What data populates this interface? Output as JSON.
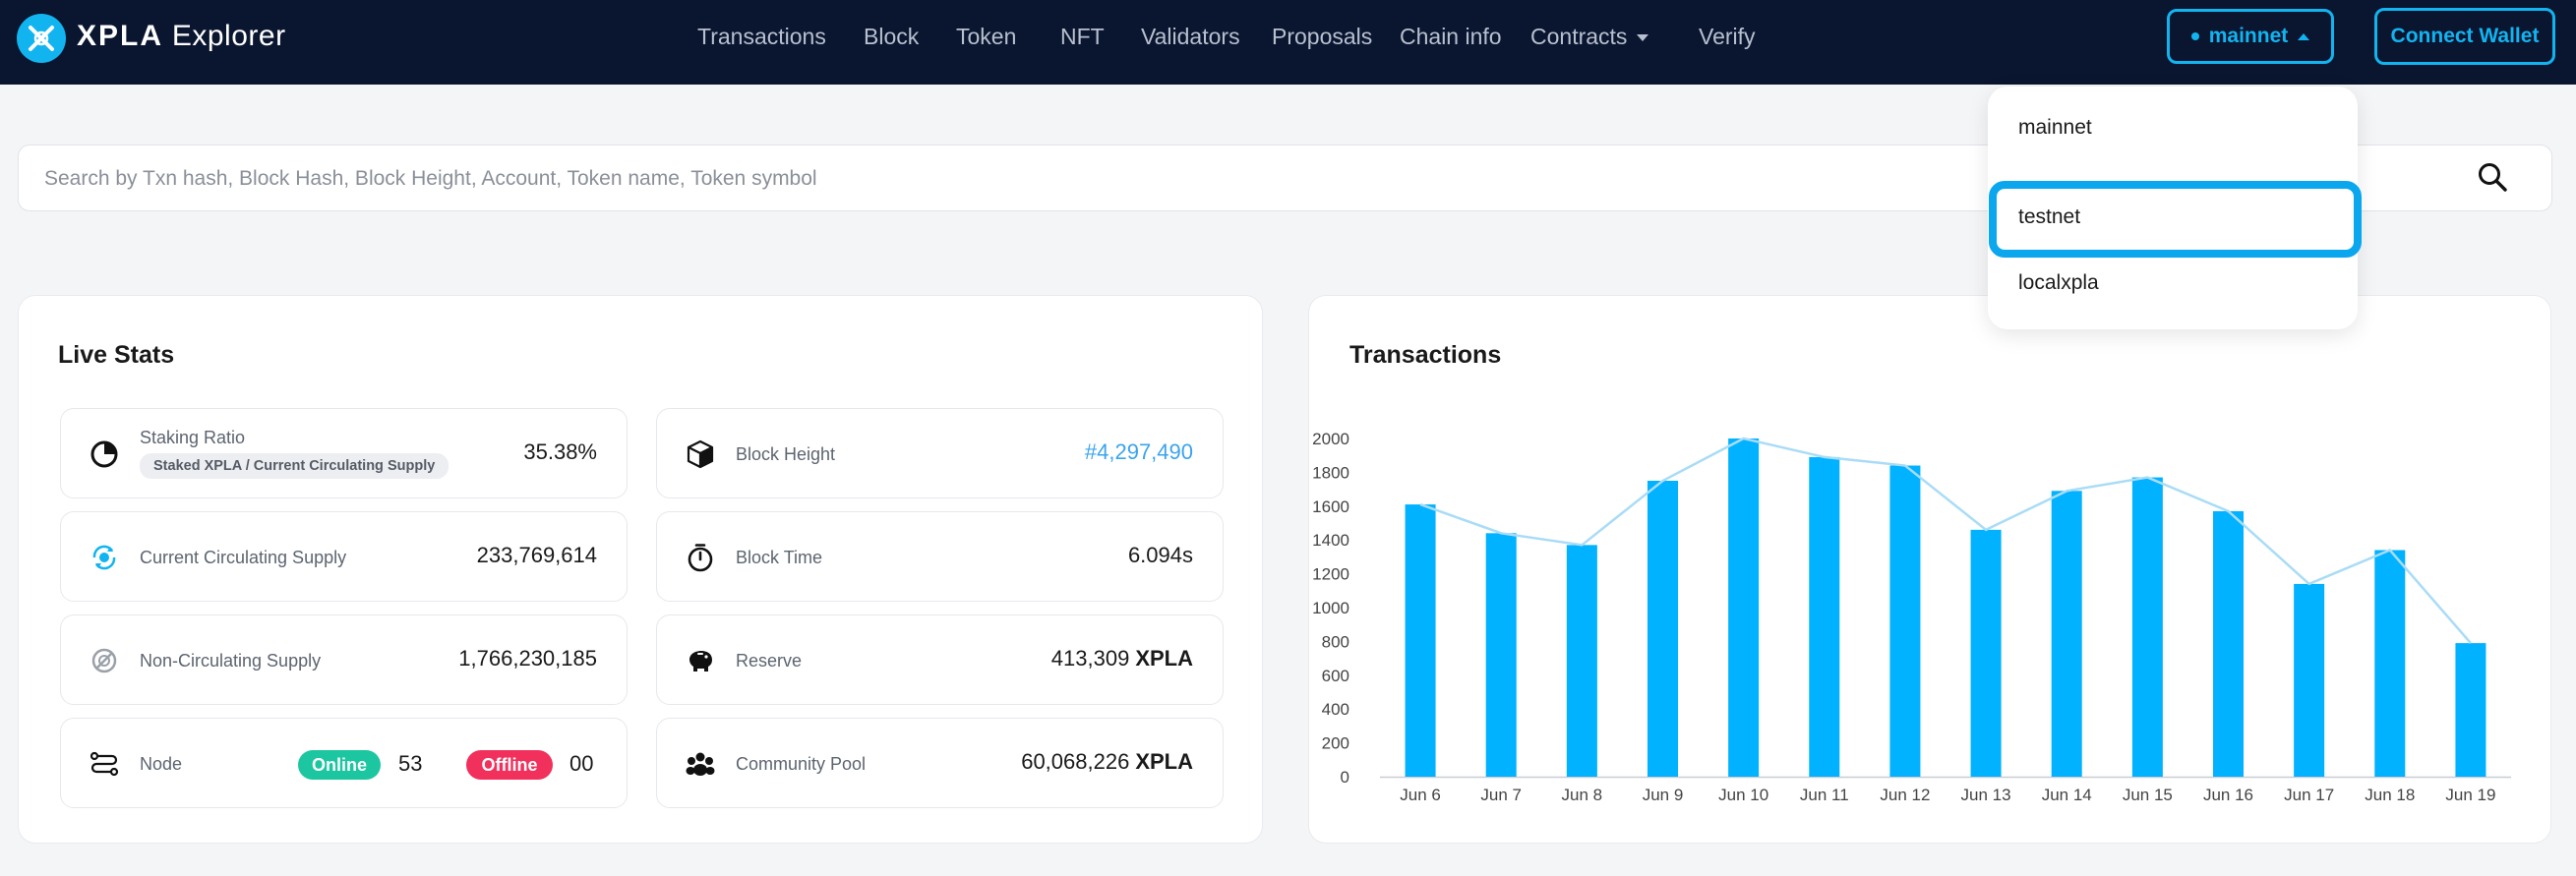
{
  "header": {
    "brand_bold": "XPLA",
    "brand_rest": "Explorer",
    "nav": [
      {
        "label": "Transactions"
      },
      {
        "label": "Block"
      },
      {
        "label": "Token"
      },
      {
        "label": "NFT"
      },
      {
        "label": "Validators"
      },
      {
        "label": "Proposals"
      },
      {
        "label": "Chain info"
      },
      {
        "label": "Contracts"
      },
      {
        "label": "Verify"
      }
    ],
    "network_label": "mainnet",
    "connect_label": "Connect Wallet"
  },
  "network_menu": {
    "options": [
      "mainnet",
      "testnet",
      "localxpla"
    ],
    "highlighted": "testnet"
  },
  "search": {
    "placeholder": "Search by Txn hash, Block Hash, Block Height, Account, Token name, Token symbol"
  },
  "live_stats": {
    "title": "Live Stats",
    "staking_ratio": {
      "label": "Staking Ratio",
      "sub": "Staked XPLA / Current Circulating Supply",
      "value": "35.38%"
    },
    "circulating": {
      "label": "Current Circulating Supply",
      "value": "233,769,614"
    },
    "non_circulating": {
      "label": "Non-Circulating Supply",
      "value": "1,766,230,185"
    },
    "node": {
      "label": "Node",
      "online_label": "Online",
      "online_count": "53",
      "offline_label": "Offline",
      "offline_count": "00"
    },
    "block_height": {
      "label": "Block Height",
      "value": "#4,297,490"
    },
    "block_time": {
      "label": "Block Time",
      "value": "6.094s"
    },
    "reserve": {
      "label": "Reserve",
      "value": "413,309",
      "unit": "XPLA"
    },
    "community_pool": {
      "label": "Community Pool",
      "value": "60,068,226",
      "unit": "XPLA"
    }
  },
  "colors": {
    "accent": "#12b4f0",
    "bar": "#00b2ff",
    "line": "#a9dcf6",
    "online": "#1cc6a0",
    "offline": "#f2305c",
    "link": "#3ba4ee",
    "nav_bg": "#0a1530"
  },
  "chart_data": {
    "type": "bar",
    "title": "Transactions",
    "categories": [
      "Jun 6",
      "Jun 7",
      "Jun 8",
      "Jun 9",
      "Jun 10",
      "Jun 11",
      "Jun 12",
      "Jun 13",
      "Jun 14",
      "Jun 15",
      "Jun 16",
      "Jun 17",
      "Jun 18",
      "Jun 19"
    ],
    "values": [
      1610,
      1440,
      1370,
      1750,
      2000,
      1890,
      1840,
      1460,
      1690,
      1770,
      1570,
      1140,
      1340,
      790
    ],
    "overlay_line": true,
    "ylim": [
      0,
      2000
    ],
    "yticks": [
      0,
      200,
      400,
      600,
      800,
      1000,
      1200,
      1400,
      1600,
      1800,
      2000
    ],
    "grid": false
  }
}
